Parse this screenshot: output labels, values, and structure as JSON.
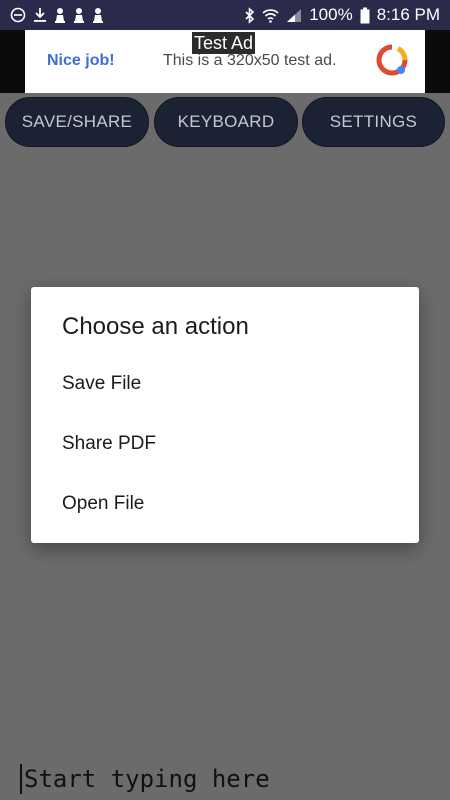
{
  "status_bar": {
    "battery": "100%",
    "time": "8:16 PM"
  },
  "ad": {
    "label": "Test Ad",
    "nice_job": "Nice job!",
    "text": "This is a 320x50 test ad."
  },
  "toolbar": {
    "save_share": "SAVE/SHARE",
    "keyboard": "KEYBOARD",
    "settings": "SETTINGS"
  },
  "dialog": {
    "title": "Choose an action",
    "items": [
      {
        "label": "Save File"
      },
      {
        "label": "Share PDF"
      },
      {
        "label": "Open File"
      }
    ]
  },
  "editor": {
    "placeholder": "Start typing here"
  },
  "colors": {
    "status_bar": "#2c2a4a",
    "button_bg": "#1a2234",
    "button_text": "#c5c8d1",
    "scrim": "#6b6b6b",
    "ad_link": "#3f6fd1"
  }
}
